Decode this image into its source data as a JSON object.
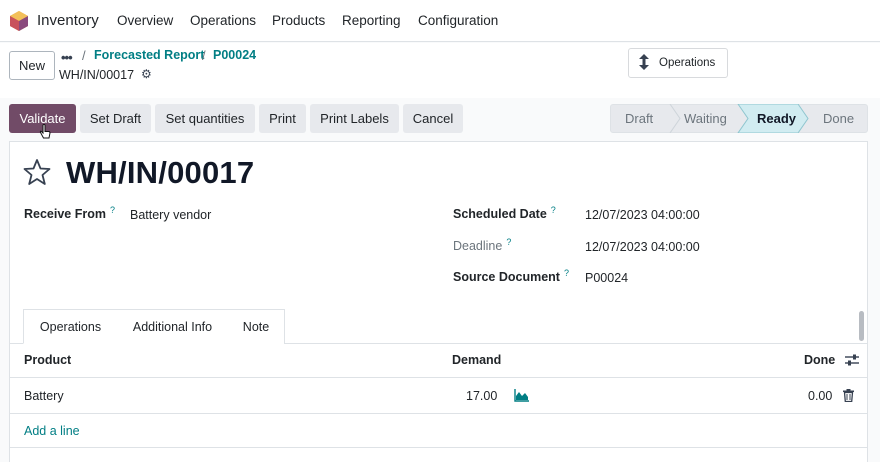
{
  "topnav": {
    "app_name": "Inventory",
    "menus": [
      "Overview",
      "Operations",
      "Products",
      "Reporting",
      "Configuration"
    ]
  },
  "control": {
    "new_label": "New",
    "dots": "•••",
    "breadcrumb": [
      "Forecasted Report",
      "P00024"
    ],
    "breadcrumb_sep": "/",
    "record_name": "WH/IN/00017",
    "smart_button_label": "Operations"
  },
  "actions": {
    "validate": "Validate",
    "set_draft": "Set Draft",
    "set_quantities": "Set quantities",
    "print": "Print",
    "print_labels": "Print Labels",
    "cancel": "Cancel"
  },
  "status": {
    "stages": [
      "Draft",
      "Waiting",
      "Ready",
      "Done"
    ],
    "current": "Ready"
  },
  "form": {
    "title": "WH/IN/00017",
    "receive_from_label": "Receive From",
    "receive_from_value": "Battery vendor",
    "scheduled_date_label": "Scheduled Date",
    "scheduled_date_value": "12/07/2023 04:00:00",
    "deadline_label": "Deadline",
    "deadline_value": "12/07/2023 04:00:00",
    "source_document_label": "Source Document",
    "source_document_value": "P00024",
    "help_mark": "?"
  },
  "tabs": [
    "Operations",
    "Additional Info",
    "Note"
  ],
  "table": {
    "headers": {
      "product": "Product",
      "demand": "Demand",
      "done": "Done"
    },
    "rows": [
      {
        "product": "Battery",
        "demand": "17.00",
        "done": "0.00"
      }
    ],
    "add_line": "Add a line"
  },
  "colors": {
    "brand": "#714b67",
    "link": "#017e84",
    "status_active": "#d1ecf1"
  }
}
